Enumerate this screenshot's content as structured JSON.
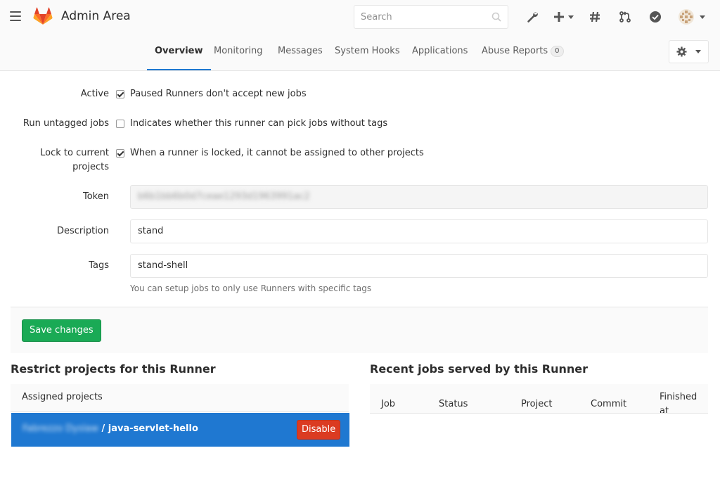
{
  "navbar": {
    "brand": "Admin Area",
    "search_placeholder": "Search"
  },
  "tabs": [
    {
      "label": "Overview",
      "active": true
    },
    {
      "label": "Monitoring"
    },
    {
      "label": "Messages"
    },
    {
      "label": "System Hooks"
    },
    {
      "label": "Applications"
    },
    {
      "label": "Abuse Reports",
      "badge": "0"
    }
  ],
  "form": {
    "active": {
      "label": "Active",
      "checked": true,
      "text": "Paused Runners don't accept new jobs"
    },
    "untagged": {
      "label": "Run untagged jobs",
      "checked": false,
      "text": "Indicates whether this runner can pick jobs without tags"
    },
    "lock": {
      "label": "Lock to current projects",
      "checked": true,
      "text": "When a runner is locked, it cannot be assigned to other projects"
    },
    "token": {
      "label": "Token",
      "value": "b6b1bb6b0d7ceae1293d1963991ac2"
    },
    "description": {
      "label": "Description",
      "value": "stand"
    },
    "tags": {
      "label": "Tags",
      "value": "stand-shell",
      "help": "You can setup jobs to only use Runners with specific tags"
    },
    "save_label": "Save changes"
  },
  "restrict": {
    "title": "Restrict projects for this Runner",
    "assigned_header": "Assigned projects",
    "project_namespace": "Fabrezzo Dyslaw",
    "project_separator": " / ",
    "project_name": "java-servlet-hello",
    "disable_label": "Disable"
  },
  "jobs": {
    "title": "Recent jobs served by this Runner",
    "columns": [
      "Job",
      "Status",
      "Project",
      "Commit",
      "Finished at"
    ]
  },
  "colors": {
    "accent": "#1f78d1",
    "save": "#1aaa55",
    "danger": "#db3b21"
  }
}
